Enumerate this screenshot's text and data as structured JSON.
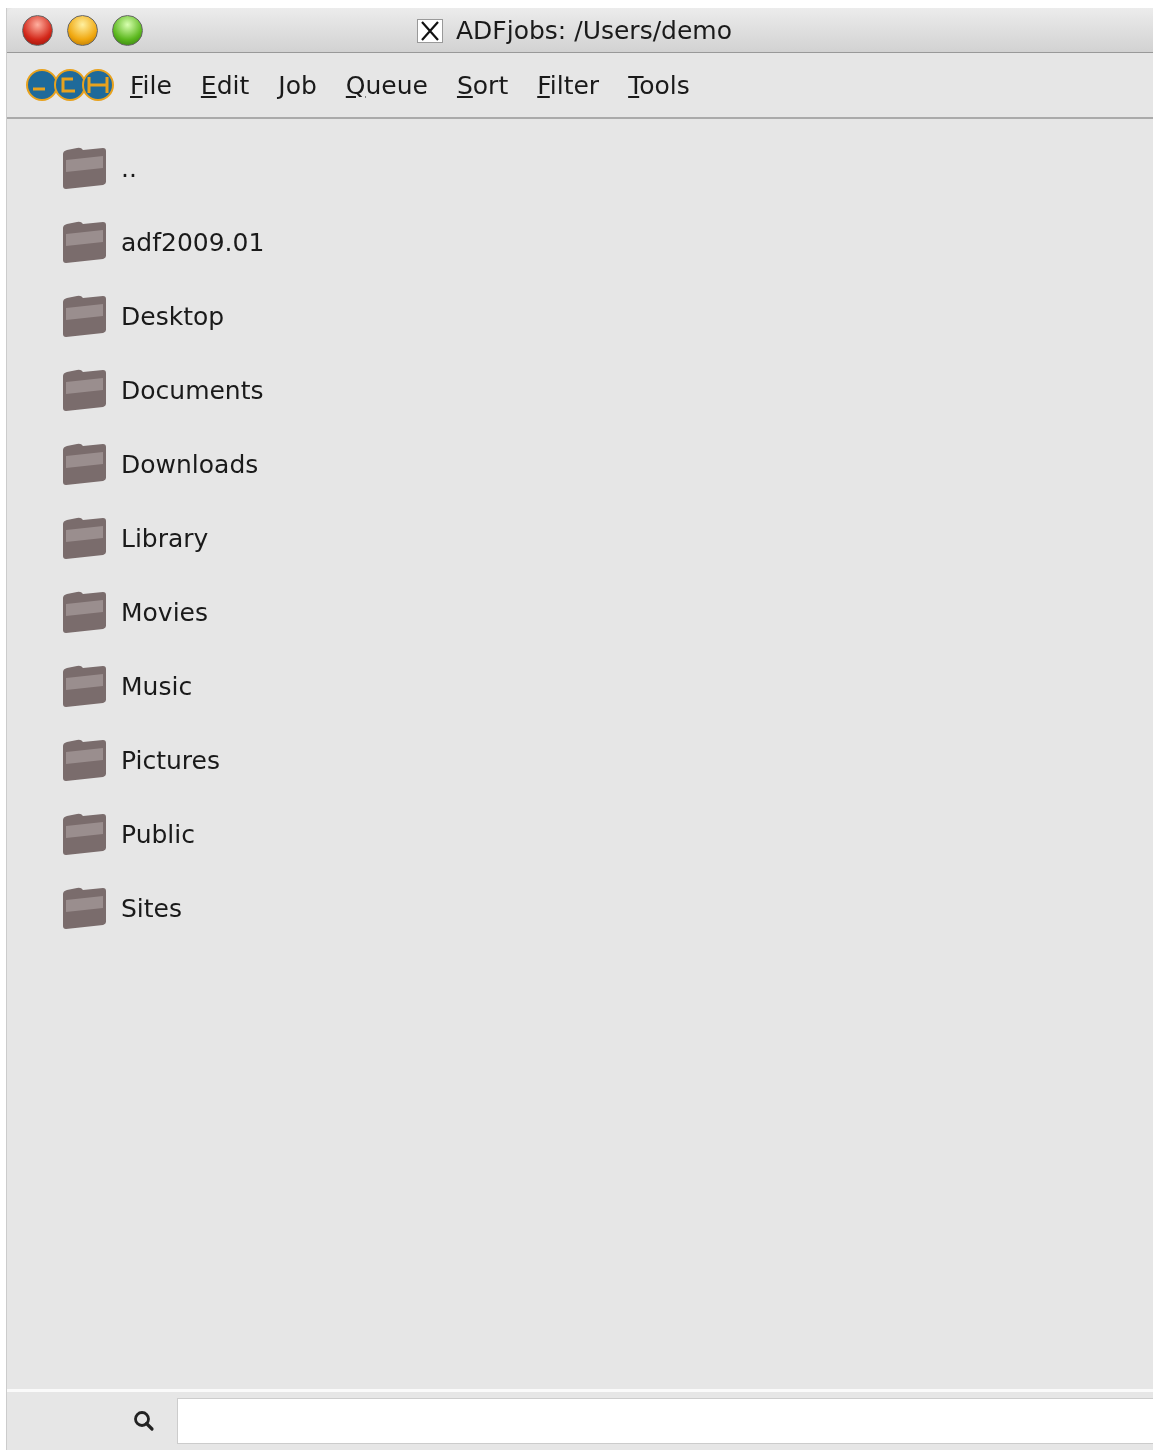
{
  "window": {
    "title": "ADFjobs: /Users/demo"
  },
  "menu": [
    "File",
    "Edit",
    "Job",
    "Queue",
    "Sort",
    "Filter",
    "Tools"
  ],
  "folders": [
    {
      "name": ".."
    },
    {
      "name": "adf2009.01"
    },
    {
      "name": "Desktop"
    },
    {
      "name": "Documents"
    },
    {
      "name": "Downloads"
    },
    {
      "name": "Library"
    },
    {
      "name": "Movies"
    },
    {
      "name": "Music"
    },
    {
      "name": "Pictures"
    },
    {
      "name": "Public"
    },
    {
      "name": "Sites"
    }
  ]
}
